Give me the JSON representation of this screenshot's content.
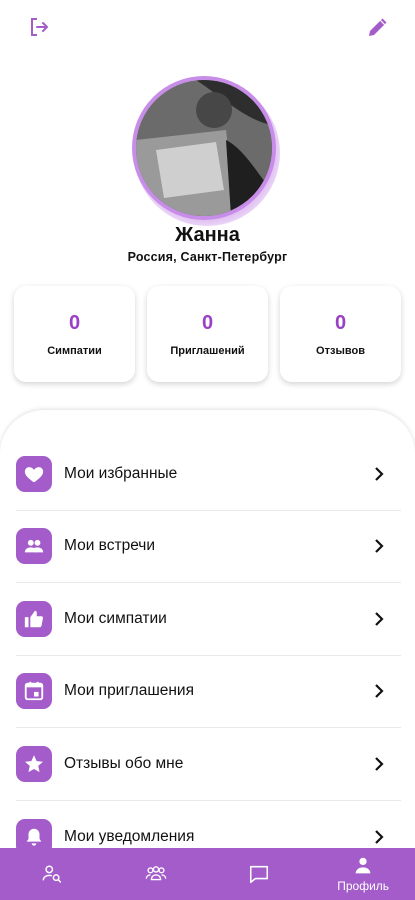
{
  "header": {
    "logout_icon": "logout-icon",
    "edit_icon": "pencil-icon"
  },
  "profile": {
    "name": "Жанна",
    "location": "Россия, Санкт-Петербург"
  },
  "stats": [
    {
      "value": "0",
      "label": "Симпатии"
    },
    {
      "value": "0",
      "label": "Приглашений"
    },
    {
      "value": "0",
      "label": "Отзывов"
    }
  ],
  "menu": [
    {
      "label": "Мои избранные",
      "icon": "heart-icon"
    },
    {
      "label": "Мои встречи",
      "icon": "people-icon"
    },
    {
      "label": "Мои симпатии",
      "icon": "thumbs-up-icon"
    },
    {
      "label": "Мои приглашения",
      "icon": "calendar-icon"
    },
    {
      "label": "Отзывы обо мне",
      "icon": "star-icon"
    },
    {
      "label": "Мои уведомления",
      "icon": "bell-icon"
    }
  ],
  "bottom_nav": [
    {
      "icon": "search-user-icon",
      "label": ""
    },
    {
      "icon": "group-icon",
      "label": ""
    },
    {
      "icon": "chat-icon",
      "label": ""
    },
    {
      "icon": "profile-icon",
      "label": "Профиль"
    }
  ],
  "colors": {
    "accent": "#a35cc9",
    "stat_value": "#9b3fc7"
  }
}
